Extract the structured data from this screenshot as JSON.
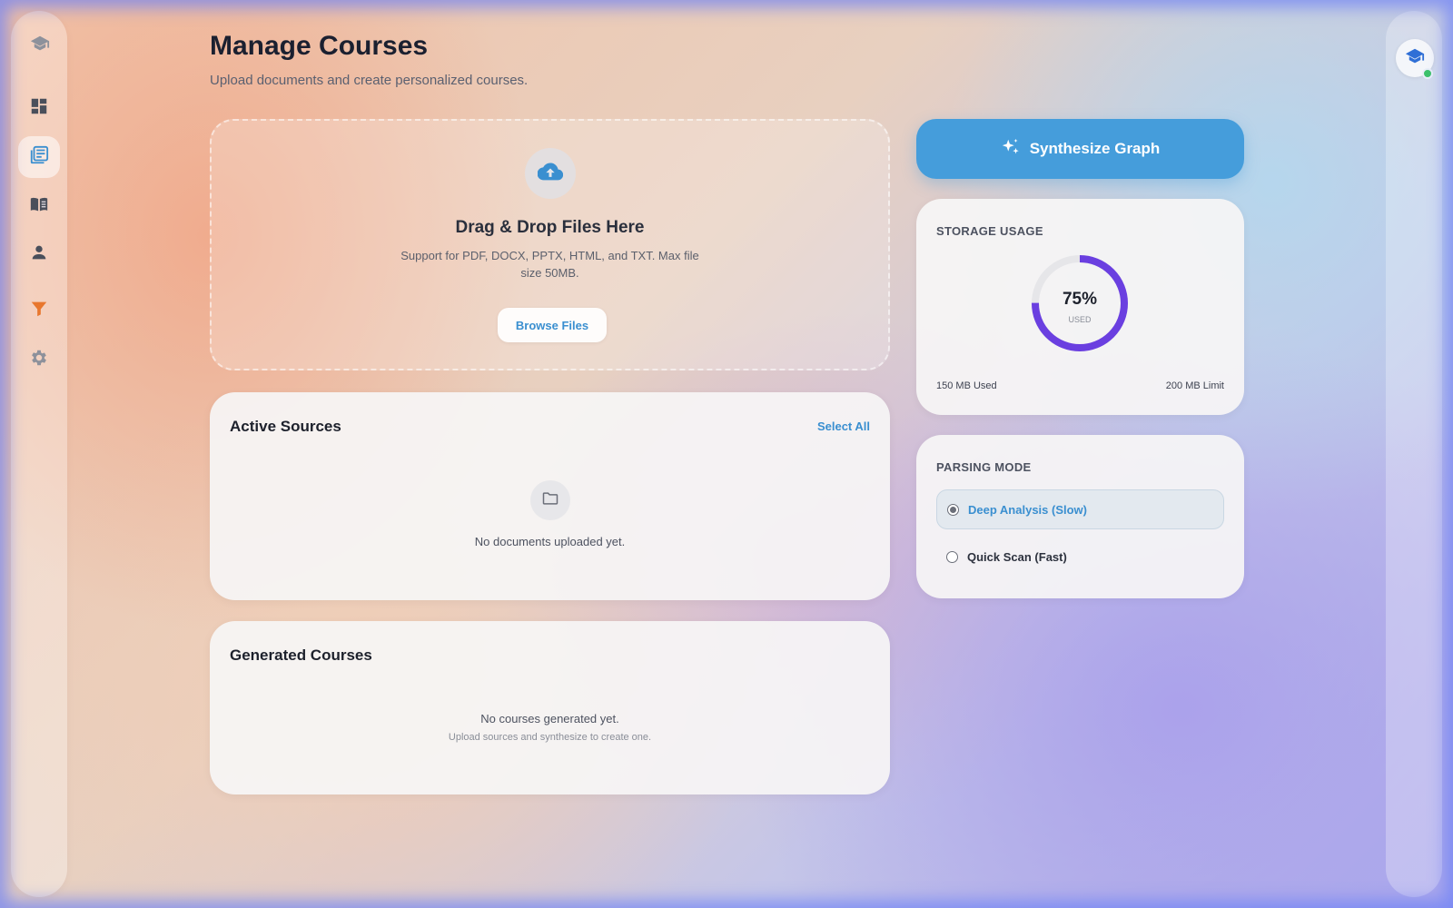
{
  "header": {
    "title": "Manage Courses",
    "subtitle": "Upload documents and create personalized courses."
  },
  "sidebar": {
    "logo_icon": "graduation-cap-icon",
    "items": [
      {
        "icon": "dashboard-icon",
        "active": false
      },
      {
        "icon": "document-list-icon",
        "active": true
      },
      {
        "icon": "book-icon",
        "active": false
      },
      {
        "icon": "person-icon",
        "active": false
      },
      {
        "icon": "funnel-icon",
        "active": false
      },
      {
        "icon": "gear-icon",
        "active": false
      }
    ]
  },
  "upload": {
    "icon": "cloud-upload-icon",
    "title": "Drag & Drop Files Here",
    "description": "Support for PDF, DOCX, PPTX, HTML, and TXT. Max file size 50MB.",
    "browse_label": "Browse Files"
  },
  "active_sources": {
    "title": "Active Sources",
    "select_all_label": "Select All",
    "empty_icon": "folder-icon",
    "empty_text": "No documents uploaded yet."
  },
  "generated_courses": {
    "title": "Generated Courses",
    "empty_text": "No courses generated yet.",
    "empty_subtext": "Upload sources and synthesize to create one."
  },
  "synthesize": {
    "icon": "sparkles-icon",
    "label": "Synthesize Graph"
  },
  "storage": {
    "label": "STORAGE USAGE",
    "percent_text": "75%",
    "percent_value": 75,
    "used_caption": "USED",
    "used_text": "150 MB Used",
    "limit_text": "200 MB Limit"
  },
  "parsing_mode": {
    "label": "PARSING MODE",
    "options": [
      {
        "label": "Deep Analysis (Slow)",
        "selected": true
      },
      {
        "label": "Quick Scan (Fast)",
        "selected": false
      }
    ]
  },
  "colors": {
    "accent": "#459ddb",
    "link": "#3a8fd0",
    "donut": "#6a3fe0",
    "donut_track": "#e6e6e9",
    "funnel": "#e8772e",
    "online": "#3cc26b"
  }
}
